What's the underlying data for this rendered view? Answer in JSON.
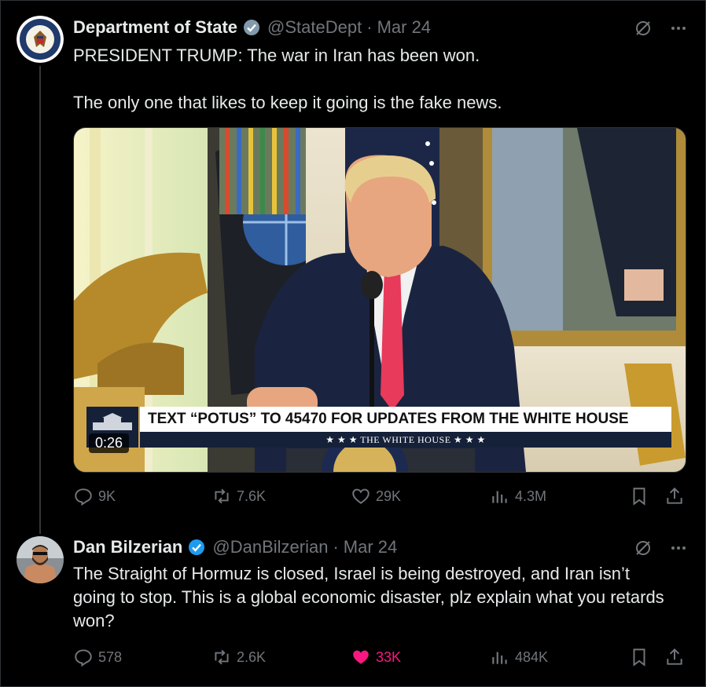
{
  "tweets": [
    {
      "name": "Department of State",
      "handle": "@StateDept",
      "separator": "·",
      "date": "Mar 24",
      "lines": [
        "PRESIDENT TRUMP: The war in Iran has been won.",
        "The only one that likes to keep it going is the fake news."
      ],
      "media": {
        "chyron_main": "TEXT “POTUS” TO 45470 FOR UPDATES FROM THE WHITE HOUSE",
        "chyron_sub": "★ ★ ★   THE WHITE HOUSE   ★ ★ ★",
        "duration": "0:26"
      },
      "actions": {
        "replies": "9K",
        "reposts": "7.6K",
        "likes": "29K",
        "views": "4.3M"
      }
    },
    {
      "name": "Dan Bilzerian",
      "handle": "@DanBilzerian",
      "separator": "·",
      "date": "Mar 24",
      "lines": [
        "The Straight of Hormuz is closed, Israel is being destroyed, and Iran isn’t going to stop. This is a global economic disaster, plz explain what you retards won?"
      ],
      "actions": {
        "replies": "578",
        "reposts": "2.6K",
        "likes": "33K",
        "views": "484K"
      }
    }
  ],
  "colors": {
    "background": "#000000",
    "text": "#e7e9ea",
    "muted": "#71767b",
    "verified": "#1d9bf0",
    "like_active": "#f91880"
  },
  "icons": [
    "verified-badge-icon",
    "grok-icon",
    "more-icon",
    "reply-icon",
    "repost-icon",
    "like-icon",
    "views-icon",
    "bookmark-icon",
    "share-icon"
  ]
}
